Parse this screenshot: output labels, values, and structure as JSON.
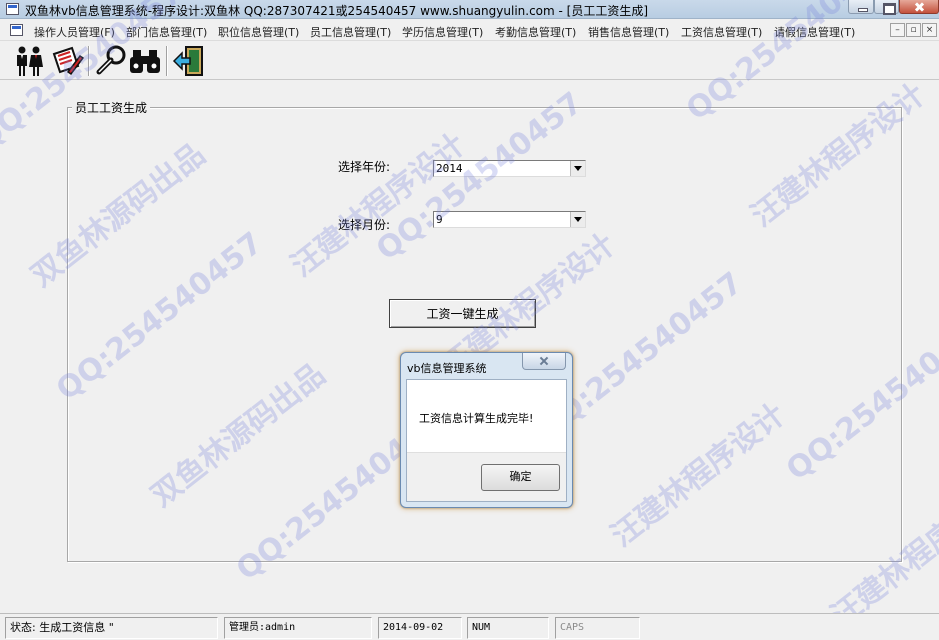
{
  "window": {
    "title": "双鱼林vb信息管理系统-程序设计:双鱼林 QQ:287307421或254540457 www.shuangyulin.com - [员工工资生成]"
  },
  "menu": {
    "items": [
      {
        "label": "操作人员管理(F)"
      },
      {
        "label": "部门信息管理(T)"
      },
      {
        "label": "职位信息管理(T)"
      },
      {
        "label": "员工信息管理(T)"
      },
      {
        "label": "学历信息管理(T)"
      },
      {
        "label": "考勤信息管理(T)"
      },
      {
        "label": "销售信息管理(T)"
      },
      {
        "label": "工资信息管理(T)"
      },
      {
        "label": "请假信息管理(T)"
      }
    ]
  },
  "toolbar": {
    "tools": [
      {
        "icon": "people-icon"
      },
      {
        "icon": "edit-document-icon"
      },
      {
        "icon": "wrench-icon"
      },
      {
        "icon": "binoculars-icon"
      },
      {
        "icon": "exit-door-icon"
      }
    ]
  },
  "form": {
    "group_title": "员工工资生成",
    "year_label": "选择年份:",
    "year_value": "2014",
    "month_label": "选择月份:",
    "month_value": "9",
    "generate_button": "工资一键生成"
  },
  "dialog": {
    "title": "vb信息管理系统",
    "message": "工资信息计算生成完毕!",
    "ok_button": "确定"
  },
  "watermark": {
    "qq": "QQ:254540457",
    "cn1": "双鱼林源码出品",
    "cn2": "汪建林程序设计"
  },
  "status": {
    "state": "状态:  生成工资信息 \"",
    "user": "管理员:admin",
    "date": "2014-09-02",
    "num": "NUM",
    "caps": "CAPS"
  }
}
